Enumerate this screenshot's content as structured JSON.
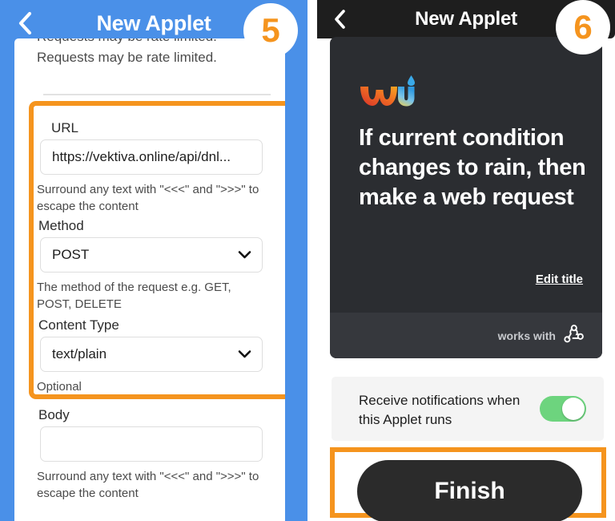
{
  "left_screen": {
    "header": {
      "title": "New Applet",
      "back_icon": "chevron-left-icon",
      "bg_color": "#4a90e8"
    },
    "step_badge": "5",
    "clipped_text": "Requests may be rate limited.",
    "rate_limit_text": "Requests may be rate limited.",
    "fields": [
      {
        "label": "URL",
        "value": "https://vektiva.online/api/dnl...",
        "help": "Surround any text with \"<<<\" and \">>>\" to escape the content",
        "type": "text"
      },
      {
        "label": "Method",
        "value": "POST",
        "help": "The method of the request e.g. GET, POST, DELETE",
        "type": "select"
      },
      {
        "label": "Content Type",
        "value": "text/plain",
        "help": "Optional",
        "type": "select"
      },
      {
        "label": "Body",
        "value": "",
        "help": "Surround any text with \"<<<\" and \">>>\" to escape the content",
        "type": "text"
      }
    ]
  },
  "right_screen": {
    "header": {
      "title": "New Applet",
      "back_icon": "chevron-left-icon",
      "bg_color": "#1e1e1e"
    },
    "step_badge": "6",
    "service_logo": "weather-underground-logo",
    "applet_title": "If current condition changes to rain, then make a web request",
    "edit_title_link": "Edit title",
    "works_with_label": "works with",
    "works_with_icon": "webhooks-icon",
    "notification": {
      "text": "Receive notifications when this Applet runs",
      "toggle_on": true,
      "toggle_color": "#6dd47e"
    },
    "finish_button": "Finish"
  },
  "highlight_color": "#f5941e"
}
